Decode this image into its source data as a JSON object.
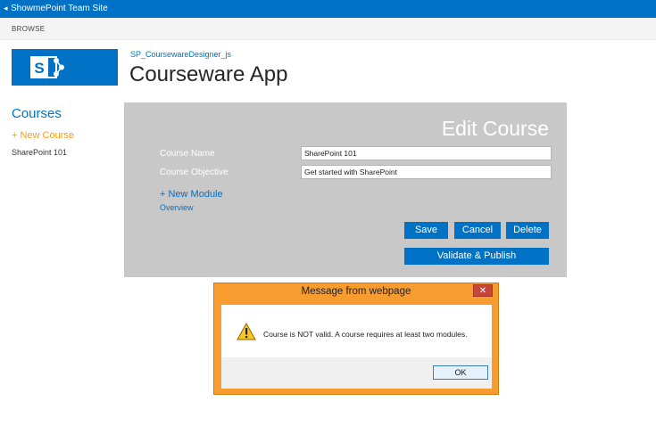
{
  "topbar": {
    "caret": "◂",
    "site_name": "ShowmePoint Team Site"
  },
  "ribbon": {
    "tab": "BROWSE"
  },
  "header": {
    "breadcrumb": "SP_CoursewareDesigner_js",
    "title": "Courseware App"
  },
  "sidebar": {
    "heading": "Courses",
    "new_course": "+ New Course",
    "items": [
      {
        "label": "SharePoint 101"
      }
    ]
  },
  "edit_course": {
    "title": "Edit Course",
    "course_name_label": "Course Name",
    "course_name_value": "SharePoint 101",
    "course_objective_label": "Course Objective",
    "course_objective_value": "Get started with SharePoint",
    "new_module": "+ New Module",
    "overview": "Overview",
    "buttons": {
      "save": "Save",
      "cancel": "Cancel",
      "delete": "Delete",
      "validate": "Validate & Publish"
    }
  },
  "dialog": {
    "title": "Message from webpage",
    "close": "✕",
    "message": "Course is NOT valid. A course requires at least two modules.",
    "ok": "OK"
  },
  "colors": {
    "brand": "#0072c6",
    "accent": "#f89c0e",
    "panel": "#c8c8c8",
    "dialog_frame": "#f89c30"
  }
}
